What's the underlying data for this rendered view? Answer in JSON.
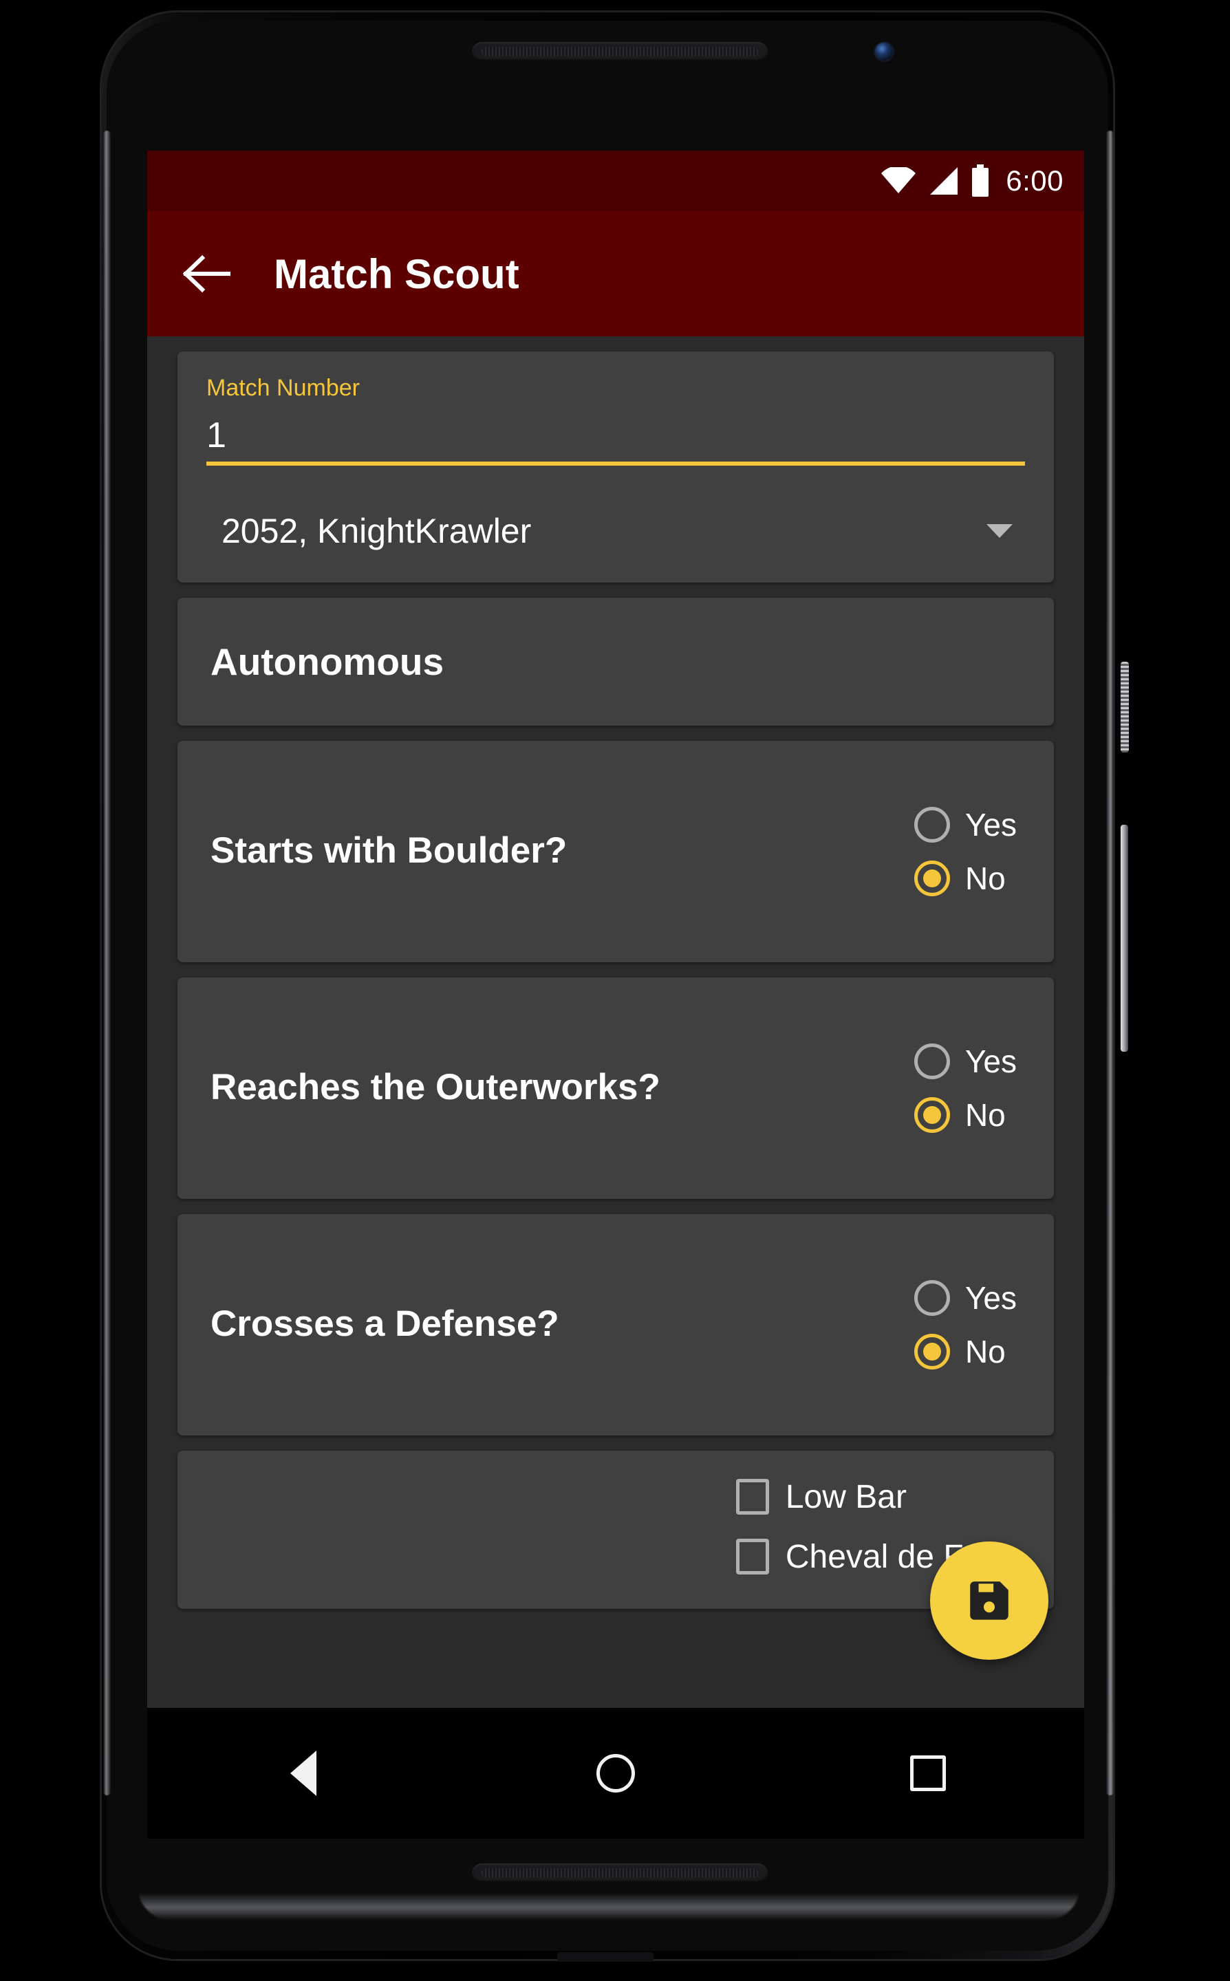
{
  "device": {
    "speaker_top": "earpiece-speaker",
    "speaker_bottom": "loud-speaker",
    "front_camera": "front-camera",
    "power_button": "power-button",
    "volume_button": "volume-rocker",
    "usb_port": "usb-port"
  },
  "status_bar": {
    "time": "6:00",
    "icons": [
      "wifi-icon",
      "cellular-signal-icon",
      "battery-icon"
    ],
    "background": "#4a0000"
  },
  "app_bar": {
    "back_label": "back-arrow-icon",
    "title": "Match Scout",
    "background": "#5c0000",
    "text_color": "#ffffff"
  },
  "theme": {
    "accent": "#f5c63c",
    "fab": "#f5d142",
    "card": "#404040",
    "screen_bg": "#2b2b2b"
  },
  "match_card": {
    "label": "Match Number",
    "value": "1",
    "placeholder": "Match Number",
    "team_selected": "2052, KnightKrawler",
    "caret": "chevron-down-icon"
  },
  "sections": {
    "autonomous_title": "Autonomous"
  },
  "questions": [
    {
      "label": "Starts with Boulder?",
      "options": [
        {
          "label": "Yes",
          "selected": false
        },
        {
          "label": "No",
          "selected": true
        }
      ]
    },
    {
      "label": "Reaches the Outerworks?",
      "options": [
        {
          "label": "Yes",
          "selected": false
        },
        {
          "label": "No",
          "selected": true
        }
      ]
    },
    {
      "label": "Crosses a Defense?",
      "options": [
        {
          "label": "Yes",
          "selected": false
        },
        {
          "label": "No",
          "selected": true
        }
      ]
    }
  ],
  "defense_checklist": [
    {
      "label": "Low Bar",
      "checked": false
    },
    {
      "label": "Cheval de Frise",
      "checked": false
    }
  ],
  "fab": {
    "icon": "save-icon",
    "label": "Save"
  },
  "nav_bar": {
    "back": "nav-back-icon",
    "home": "nav-home-icon",
    "recents": "nav-recents-icon"
  }
}
